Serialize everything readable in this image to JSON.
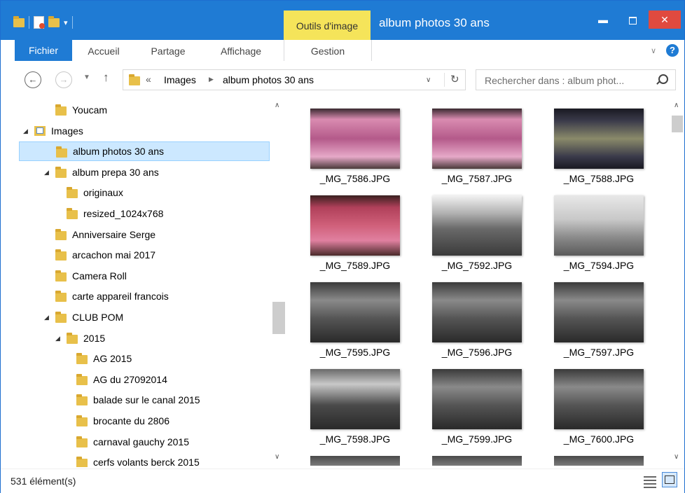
{
  "window": {
    "title": "album photos 30 ans",
    "contextual_tab": "Outils d'image",
    "accent_color": "#1f7bd4",
    "contextual_color": "#f5e45a",
    "close_color": "#e04a3f"
  },
  "quick_access": {
    "icons": [
      "folder-icon",
      "properties-icon",
      "new-folder-icon",
      "customize-arrow-icon"
    ]
  },
  "ribbon": {
    "tabs": [
      "Fichier",
      "Accueil",
      "Partage",
      "Affichage",
      "Gestion"
    ]
  },
  "address": {
    "overflow": "«",
    "crumbs": [
      "Images",
      "album photos 30 ans"
    ]
  },
  "search": {
    "placeholder": "Rechercher dans : album phot..."
  },
  "tree": [
    {
      "label": "Youcam",
      "level": 2,
      "expanded": null
    },
    {
      "label": "Images",
      "level": 1,
      "expanded": true,
      "icon": "library-icon"
    },
    {
      "label": "album photos 30 ans",
      "level": 2,
      "expanded": null,
      "selected": true
    },
    {
      "label": "album prepa 30 ans",
      "level": 2,
      "expanded": true
    },
    {
      "label": "originaux",
      "level": 3,
      "expanded": null
    },
    {
      "label": "resized_1024x768",
      "level": 3,
      "expanded": null
    },
    {
      "label": "Anniversaire Serge",
      "level": 2,
      "expanded": null
    },
    {
      "label": "arcachon mai 2017",
      "level": 2,
      "expanded": null
    },
    {
      "label": "Camera Roll",
      "level": 2,
      "expanded": null
    },
    {
      "label": "carte appareil francois",
      "level": 2,
      "expanded": null
    },
    {
      "label": "CLUB POM",
      "level": 2,
      "expanded": true
    },
    {
      "label": "2015",
      "level": 3,
      "expanded": true
    },
    {
      "label": "AG 2015",
      "level": 4,
      "expanded": null
    },
    {
      "label": "AG du 27092014",
      "level": 4,
      "expanded": null
    },
    {
      "label": "balade sur le canal 2015",
      "level": 4,
      "expanded": null
    },
    {
      "label": "brocante du 2806",
      "level": 4,
      "expanded": null
    },
    {
      "label": "carnaval gauchy 2015",
      "level": 4,
      "expanded": null
    },
    {
      "label": "cerfs volants berck 2015",
      "level": 4,
      "expanded": null
    }
  ],
  "files": [
    {
      "name": "_MG_7586.JPG",
      "tone": "cake-pink"
    },
    {
      "name": "_MG_7587.JPG",
      "tone": "cake-pink"
    },
    {
      "name": "_MG_7588.JPG",
      "tone": "cake-dark"
    },
    {
      "name": "_MG_7589.JPG",
      "tone": "cake-red"
    },
    {
      "name": "_MG_7592.JPG",
      "tone": "hall-people"
    },
    {
      "name": "_MG_7594.JPG",
      "tone": "hall-bright"
    },
    {
      "name": "_MG_7595.JPG",
      "tone": "hall-dark"
    },
    {
      "name": "_MG_7596.JPG",
      "tone": "hall-dark"
    },
    {
      "name": "_MG_7597.JPG",
      "tone": "hall-dark"
    },
    {
      "name": "_MG_7598.JPG",
      "tone": "hall-window"
    },
    {
      "name": "_MG_7599.JPG",
      "tone": "hall-dark"
    },
    {
      "name": "_MG_7600.JPG",
      "tone": "hall-dark"
    }
  ],
  "status": {
    "count": "531 élément(s)"
  }
}
